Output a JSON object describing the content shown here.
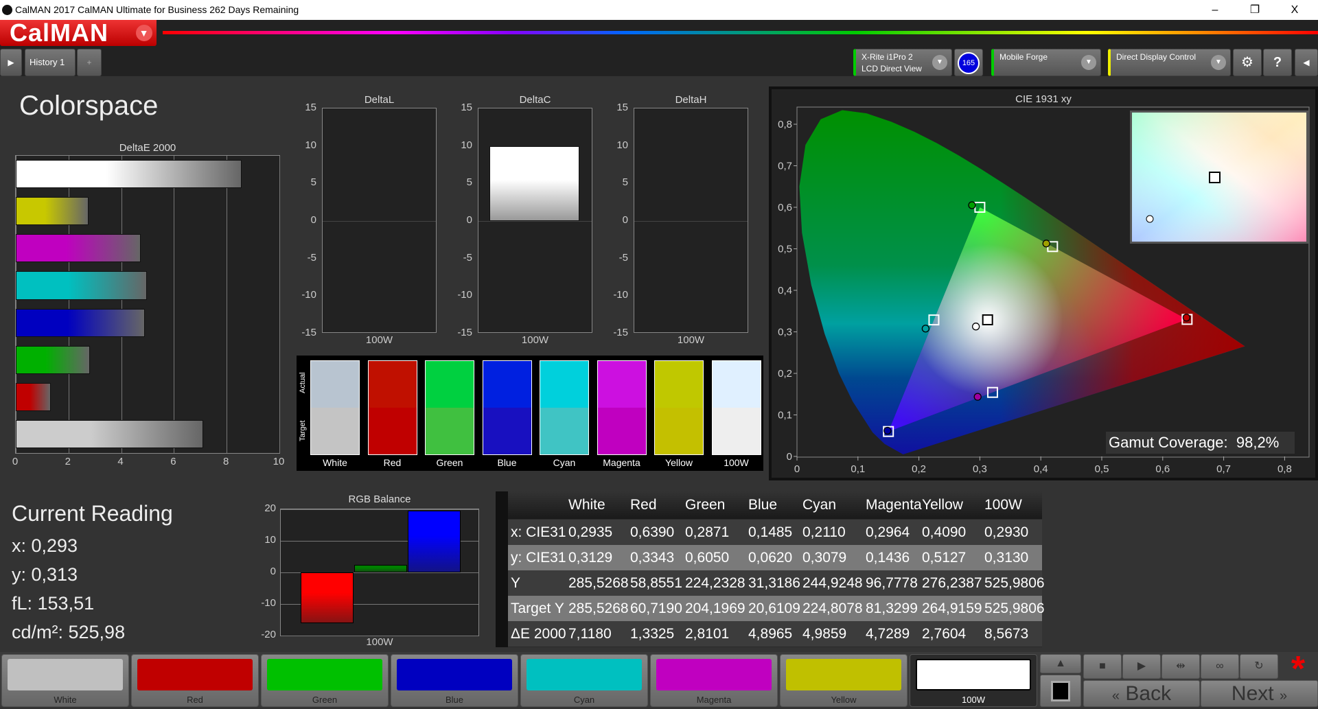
{
  "window": {
    "title": "CalMAN 2017 CalMAN Ultimate for Business 262 Days Remaining",
    "minimize": "–",
    "restore": "❐",
    "close": "X"
  },
  "logo": "CalMAN",
  "toolbar": {
    "history_tab": "History 1",
    "add_tab": "+",
    "meter_line1": "X-Rite i1Pro 2",
    "meter_line2": "LCD Direct View",
    "meter_badge": "165",
    "source": "Mobile Forge",
    "display": "Direct Display Control",
    "settings_icon": "gear-icon",
    "help": "?"
  },
  "page_title": "Colorspace",
  "deltae_chart": {
    "type": "bar",
    "title": "DeltaE 2000",
    "orientation": "horizontal",
    "categories": [
      "100W",
      "Yellow",
      "Magenta",
      "Cyan",
      "Blue",
      "Green",
      "Red",
      "White"
    ],
    "values": [
      8.5673,
      2.7604,
      4.7289,
      4.9859,
      4.8965,
      2.8101,
      1.3325,
      7.118
    ],
    "colors": [
      "#ffffff",
      "#c8c800",
      "#c000c0",
      "#00c0c0",
      "#0000c0",
      "#00b000",
      "#c00000",
      "#cccccc"
    ],
    "xlim": [
      0,
      10
    ],
    "ticks": [
      "0",
      "2",
      "4",
      "6",
      "8",
      "10"
    ],
    "grid": true
  },
  "delta_charts": [
    {
      "type": "bar",
      "title": "DeltaL",
      "categories": [
        "100W"
      ],
      "values": [
        0
      ],
      "ylim": [
        -15,
        15
      ],
      "ticks": [
        "15",
        "10",
        "5",
        "0",
        "-5",
        "-10",
        "-15"
      ]
    },
    {
      "type": "bar",
      "title": "DeltaC",
      "categories": [
        "100W"
      ],
      "values": [
        10
      ],
      "ylim": [
        -15,
        15
      ],
      "ticks": [
        "15",
        "10",
        "5",
        "0",
        "-5",
        "-10",
        "-15"
      ]
    },
    {
      "type": "bar",
      "title": "DeltaH",
      "categories": [
        "100W"
      ],
      "values": [
        0
      ],
      "ylim": [
        -15,
        15
      ],
      "ticks": [
        "15",
        "10",
        "5",
        "0",
        "-5",
        "-10",
        "-15"
      ]
    }
  ],
  "swatches": {
    "actual_label": "Actual",
    "target_label": "Target",
    "items": [
      {
        "name": "White",
        "actual": "#b8c4d0",
        "target": "#c4c4c4"
      },
      {
        "name": "Red",
        "actual": "#c01000",
        "target": "#c00000"
      },
      {
        "name": "Green",
        "actual": "#00d040",
        "target": "#40c040"
      },
      {
        "name": "Blue",
        "actual": "#0020e0",
        "target": "#1810c0"
      },
      {
        "name": "Cyan",
        "actual": "#00d0dc",
        "target": "#40c4c4"
      },
      {
        "name": "Magenta",
        "actual": "#cc10e0",
        "target": "#c000c0"
      },
      {
        "name": "Yellow",
        "actual": "#c0c800",
        "target": "#c4c000"
      },
      {
        "name": "100W",
        "actual": "#e0f0ff",
        "target": "#eeeeee"
      }
    ]
  },
  "cie_chart": {
    "type": "scatter",
    "title": "CIE 1931 xy",
    "xlim": [
      0,
      0.85
    ],
    "ylim": [
      0,
      0.85
    ],
    "xticks": [
      "0",
      "0,1",
      "0,2",
      "0,3",
      "0,4",
      "0,5",
      "0,6",
      "0,7",
      "0,8"
    ],
    "yticks": [
      "0",
      "0,1",
      "0,2",
      "0,3",
      "0,4",
      "0,5",
      "0,6",
      "0,7",
      "0,8"
    ],
    "targets": [
      {
        "name": "White",
        "x": 0.3127,
        "y": 0.329
      },
      {
        "name": "Red",
        "x": 0.64,
        "y": 0.33
      },
      {
        "name": "Green",
        "x": 0.3,
        "y": 0.6
      },
      {
        "name": "Blue",
        "x": 0.15,
        "y": 0.06
      },
      {
        "name": "Cyan",
        "x": 0.2246,
        "y": 0.3287
      },
      {
        "name": "Magenta",
        "x": 0.3209,
        "y": 0.1542
      },
      {
        "name": "Yellow",
        "x": 0.4193,
        "y": 0.5053
      }
    ],
    "measured": [
      {
        "name": "White",
        "x": 0.2935,
        "y": 0.3129,
        "color": "#ffffff"
      },
      {
        "name": "Red",
        "x": 0.639,
        "y": 0.3343,
        "color": "#c00000"
      },
      {
        "name": "Green",
        "x": 0.2871,
        "y": 0.605,
        "color": "#00a000"
      },
      {
        "name": "Blue",
        "x": 0.1485,
        "y": 0.062,
        "color": "#0000a0"
      },
      {
        "name": "Cyan",
        "x": 0.211,
        "y": 0.3079,
        "color": "#00a0a0"
      },
      {
        "name": "Magenta",
        "x": 0.2964,
        "y": 0.1436,
        "color": "#a000a0"
      },
      {
        "name": "Yellow",
        "x": 0.409,
        "y": 0.5127,
        "color": "#a0a000"
      }
    ],
    "gamut_coverage_label": "Gamut Coverage:",
    "gamut_coverage": "98,2%"
  },
  "current_reading": {
    "title": "Current Reading",
    "x": "x: 0,293",
    "y": "y: 0,313",
    "fl": "fL: 153,51",
    "cdm2": "cd/m²: 525,98"
  },
  "rgb_balance": {
    "type": "bar",
    "title": "RGB Balance",
    "category": "100W",
    "series": [
      {
        "name": "R",
        "value": -16,
        "color": "#ff0000"
      },
      {
        "name": "G",
        "value": 2.3,
        "color": "#008000"
      },
      {
        "name": "B",
        "value": 19.5,
        "color": "#0000ff"
      }
    ],
    "ylim": [
      -20,
      20
    ],
    "ticks": [
      "20",
      "10",
      "0",
      "-10",
      "-20"
    ]
  },
  "table": {
    "columns": [
      "White",
      "Red",
      "Green",
      "Blue",
      "Cyan",
      "Magenta",
      "Yellow",
      "100W"
    ],
    "rows": [
      {
        "label": "x: CIE31",
        "values": [
          "0,2935",
          "0,6390",
          "0,2871",
          "0,1485",
          "0,2110",
          "0,2964",
          "0,4090",
          "0,2930"
        ]
      },
      {
        "label": "y: CIE31",
        "values": [
          "0,3129",
          "0,3343",
          "0,6050",
          "0,0620",
          "0,3079",
          "0,1436",
          "0,5127",
          "0,3130"
        ]
      },
      {
        "label": "Y",
        "values": [
          "285,5268",
          "58,8551",
          "224,2328",
          "31,3186",
          "244,9248",
          "96,7778",
          "276,2387",
          "525,9806"
        ]
      },
      {
        "label": "Target Y",
        "values": [
          "285,5268",
          "60,7190",
          "204,1969",
          "20,6109",
          "224,8078",
          "81,3299",
          "264,9159",
          "525,9806"
        ]
      },
      {
        "label": "ΔE 2000",
        "values": [
          "7,1180",
          "1,3325",
          "2,8101",
          "4,8965",
          "4,9859",
          "4,7289",
          "2,7604",
          "8,5673"
        ]
      }
    ]
  },
  "patches": [
    {
      "label": "White",
      "color": "#c0c0c0"
    },
    {
      "label": "Red",
      "color": "#c00000"
    },
    {
      "label": "Green",
      "color": "#00c000"
    },
    {
      "label": "Blue",
      "color": "#0000c0"
    },
    {
      "label": "Cyan",
      "color": "#00c0c0"
    },
    {
      "label": "Magenta",
      "color": "#c000c0"
    },
    {
      "label": "Yellow",
      "color": "#c0c000"
    },
    {
      "label": "100W",
      "color": "#ffffff",
      "selected": true
    }
  ],
  "nav": {
    "back": "Back",
    "next": "Next",
    "back_icon": "«",
    "next_icon": "»"
  }
}
